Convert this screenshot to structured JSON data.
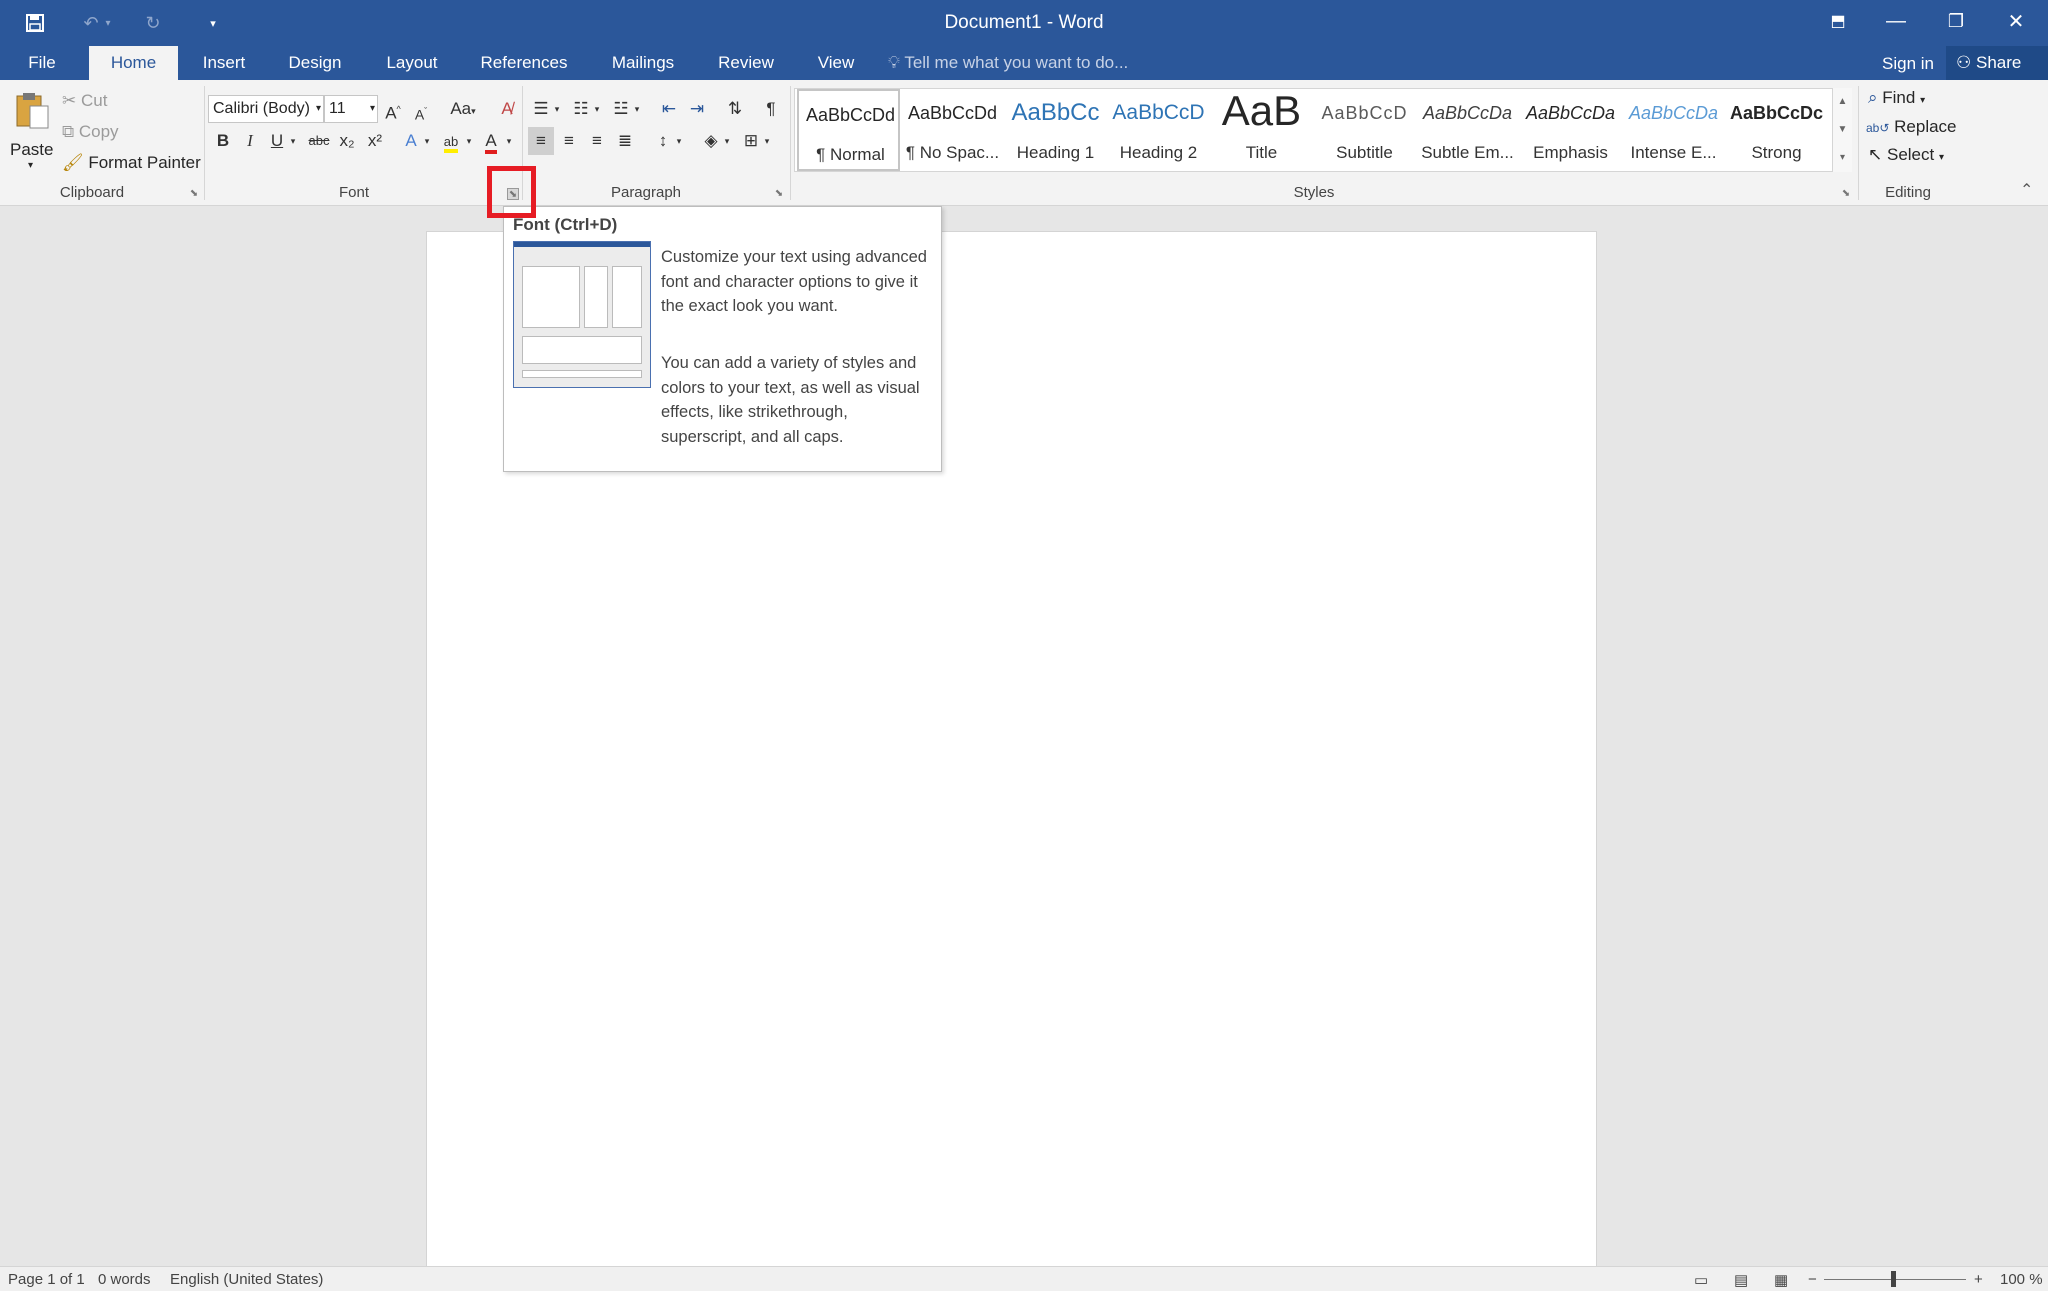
{
  "window": {
    "title": "Document1 - Word"
  },
  "quick_access": {
    "save_icon": "save-icon",
    "undo_icon": "undo-icon",
    "redo_icon": "redo-icon",
    "customize_icon": "customize-icon"
  },
  "tabs": [
    {
      "label": "File"
    },
    {
      "label": "Home"
    },
    {
      "label": "Insert"
    },
    {
      "label": "Design"
    },
    {
      "label": "Layout"
    },
    {
      "label": "References"
    },
    {
      "label": "Mailings"
    },
    {
      "label": "Review"
    },
    {
      "label": "View"
    }
  ],
  "tell_me": {
    "placeholder": "Tell me what you want to do..."
  },
  "account": {
    "sign_in": "Sign in",
    "share": "Share"
  },
  "clipboard": {
    "paste": "Paste",
    "cut": "Cut",
    "copy": "Copy",
    "format_painter": "Format Painter",
    "group": "Clipboard"
  },
  "font": {
    "name": "Calibri (Body)",
    "size": "11",
    "change_case": "Aa",
    "group": "Font",
    "bold": "B",
    "italic": "I",
    "underline": "U",
    "strike": "abc",
    "sub": "x₂",
    "sup": "x²"
  },
  "paragraph": {
    "group": "Paragraph"
  },
  "styles": {
    "group": "Styles",
    "items": [
      {
        "preview": "AaBbCcDd",
        "name": "¶ Normal"
      },
      {
        "preview": "AaBbCcDd",
        "name": "¶ No Spac..."
      },
      {
        "preview": "AaBbCc",
        "name": "Heading 1"
      },
      {
        "preview": "AaBbCcD",
        "name": "Heading 2"
      },
      {
        "preview": "AaB",
        "name": "Title"
      },
      {
        "preview": "AaBbCcD",
        "name": "Subtitle"
      },
      {
        "preview": "AaBbCcDa",
        "name": "Subtle Em..."
      },
      {
        "preview": "AaBbCcDa",
        "name": "Emphasis"
      },
      {
        "preview": "AaBbCcDa",
        "name": "Intense E..."
      },
      {
        "preview": "AaBbCcDc",
        "name": "Strong"
      }
    ]
  },
  "editing": {
    "find": "Find",
    "replace": "Replace",
    "select": "Select",
    "group": "Editing"
  },
  "tooltip": {
    "title": "Font (Ctrl+D)",
    "para1": "Customize your text using advanced font and character options to give it the exact look you want.",
    "para2": "You can add a variety of styles and colors to your text, as well as visual effects, like strikethrough, superscript, and all caps."
  },
  "status": {
    "page": "Page 1 of 1",
    "words": "0 words",
    "language": "English (United States)",
    "zoom": "100 %"
  },
  "colors": {
    "accent": "#2b579a",
    "highlight_box": "#e61c24"
  }
}
